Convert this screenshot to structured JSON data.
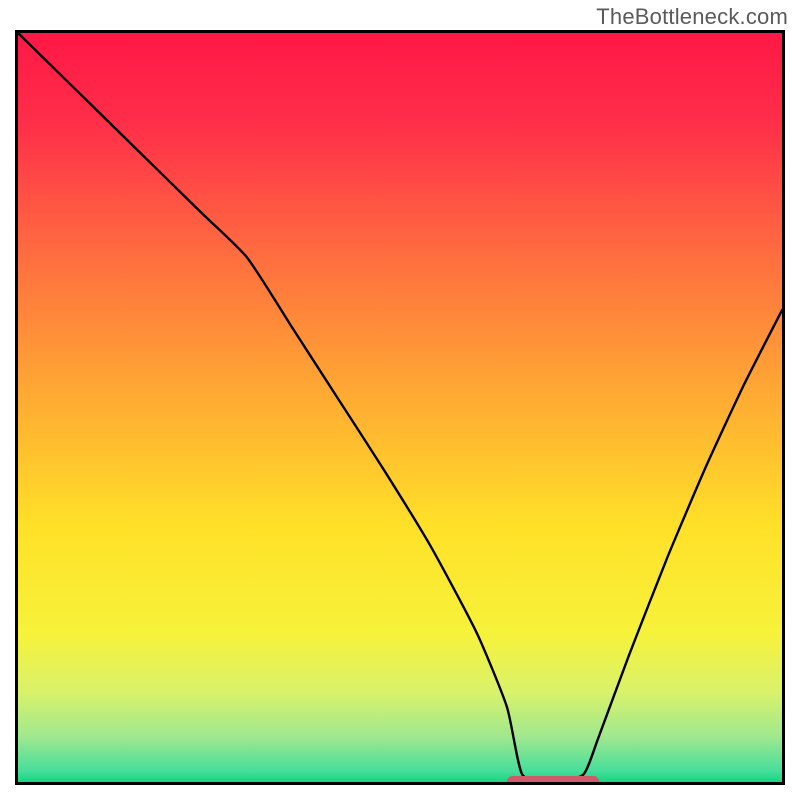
{
  "watermark": "TheBottleneck.com",
  "chart_data": {
    "type": "line",
    "title": "",
    "xlabel": "",
    "ylabel": "",
    "xlim": [
      0,
      100
    ],
    "ylim": [
      0,
      100
    ],
    "grid": false,
    "legend": false,
    "description": "V-shaped bottleneck curve over a vertical rainbow gradient (red at top through orange/yellow to green at bottom). The curve descends from the top-left corner, has a knee near x≈30, reaches its minimum near x≈66–74 at y≈0, then rises steeply toward the upper right edge (top-right corner cut off ~y≈63). A short horizontal red rounded marker sits at the minimum on the x-axis.",
    "series": [
      {
        "name": "bottleneck-curve",
        "color": "#000000",
        "x": [
          0,
          6,
          12,
          18,
          24,
          30,
          36,
          42,
          48,
          54,
          60,
          64,
          66,
          70,
          74,
          76,
          80,
          85,
          90,
          95,
          100
        ],
        "y": [
          100,
          94,
          88,
          82,
          76,
          70,
          60.5,
          51,
          41.5,
          31.5,
          20,
          10,
          1,
          0,
          1,
          6,
          17,
          30,
          42,
          53,
          63
        ]
      }
    ],
    "annotations": [
      {
        "name": "optimal-range-marker",
        "type": "hbar",
        "x_start": 64,
        "x_end": 76,
        "y": 0,
        "color": "#cf5b6a"
      }
    ],
    "background_gradient": {
      "direction": "vertical",
      "stops": [
        {
          "pos": 0.0,
          "color": "#ff1846"
        },
        {
          "pos": 0.12,
          "color": "#ff2e49"
        },
        {
          "pos": 0.3,
          "color": "#ff6e3f"
        },
        {
          "pos": 0.48,
          "color": "#ffa933"
        },
        {
          "pos": 0.66,
          "color": "#ffe128"
        },
        {
          "pos": 0.8,
          "color": "#f7f23a"
        },
        {
          "pos": 0.88,
          "color": "#d9f26a"
        },
        {
          "pos": 0.94,
          "color": "#9fe88f"
        },
        {
          "pos": 0.985,
          "color": "#47de9b"
        },
        {
          "pos": 1.0,
          "color": "#16d67f"
        }
      ]
    }
  },
  "plot": {
    "inner_width": 764,
    "inner_height": 749
  }
}
